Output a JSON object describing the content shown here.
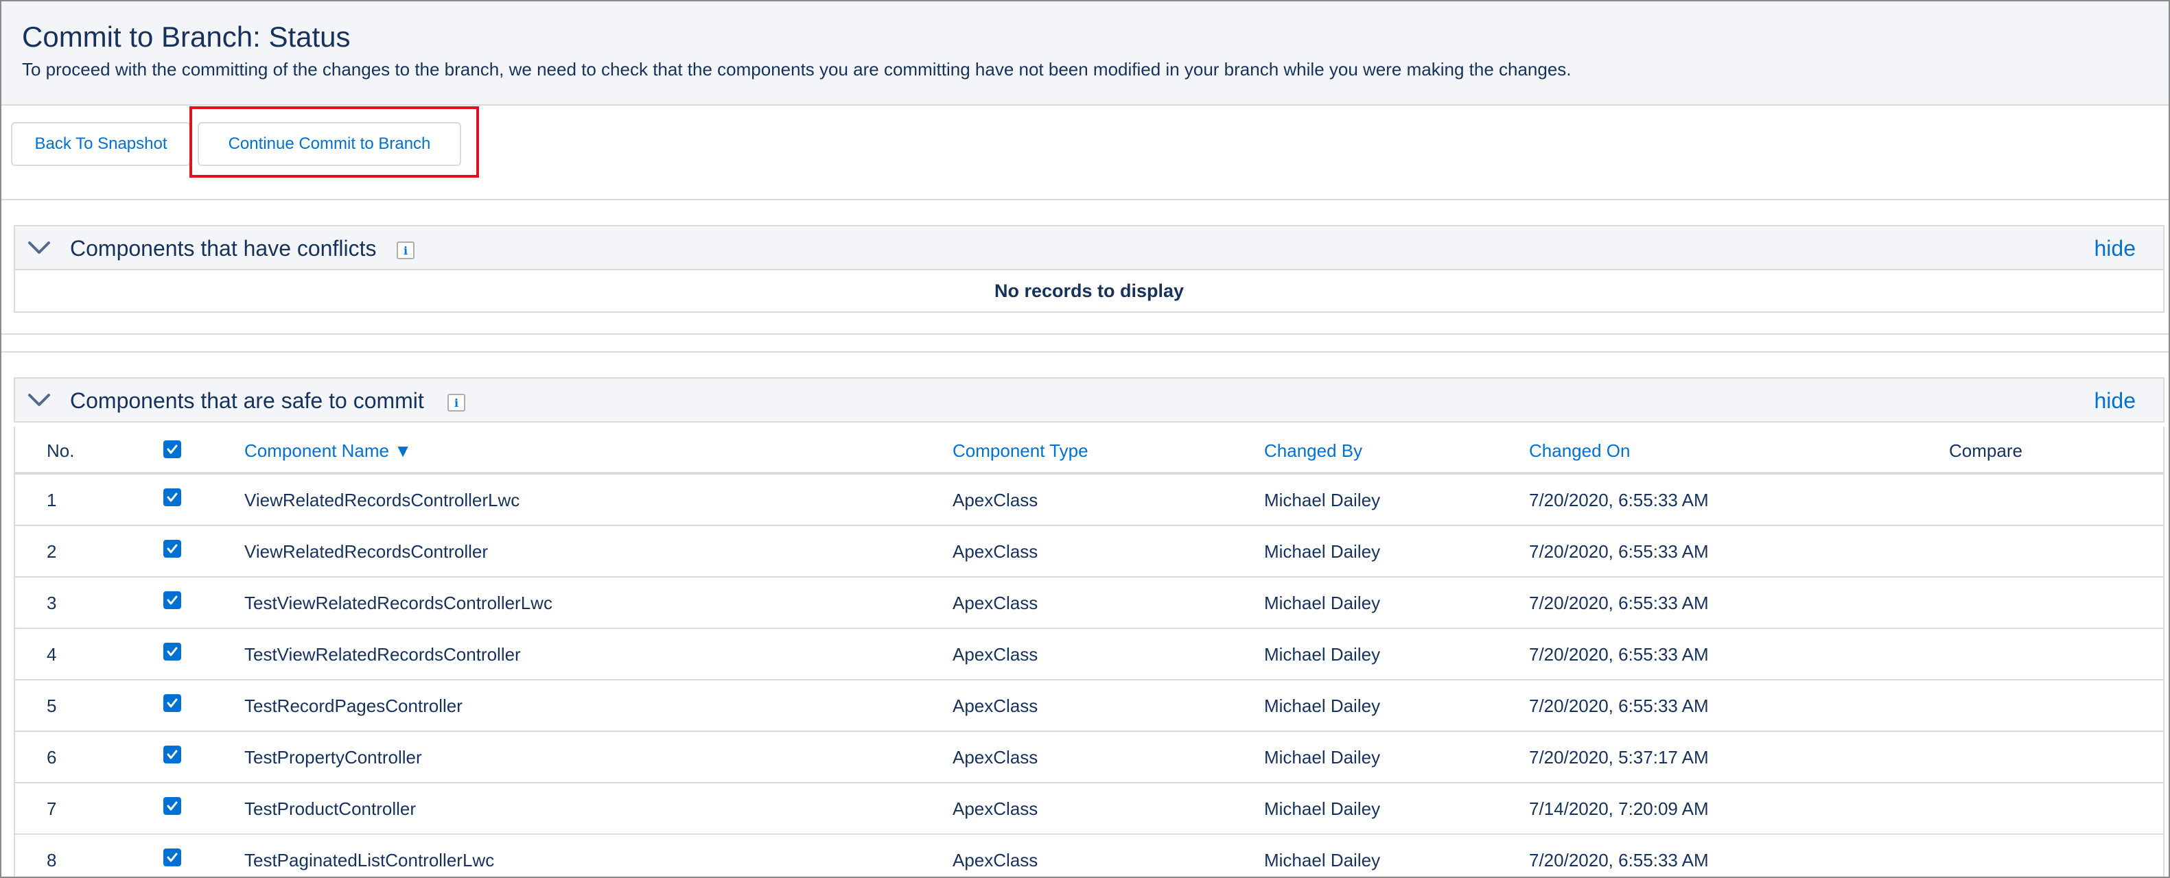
{
  "header": {
    "title": "Commit to Branch: Status",
    "description": "To proceed with the committing of the changes to the branch, we need to check that the components you are committing have not been modified in your branch while you were making the changes."
  },
  "toolbar": {
    "back_label": "Back To Snapshot",
    "continue_label": "Continue Commit to Branch"
  },
  "conflicts": {
    "title": "Components that have conflicts",
    "hide_label": "hide",
    "empty_message": "No records to display"
  },
  "safe": {
    "title": "Components that are safe to commit",
    "hide_label": "hide",
    "columns": {
      "no": "No.",
      "name": "Component Name",
      "sort_indicator": "▼",
      "type": "Component Type",
      "changed_by": "Changed By",
      "changed_on": "Changed On",
      "compare": "Compare"
    },
    "header_checked": true,
    "rows": [
      {
        "no": "1",
        "checked": true,
        "name": "ViewRelatedRecordsControllerLwc",
        "type": "ApexClass",
        "changed_by": "Michael Dailey",
        "changed_on": "7/20/2020, 6:55:33 AM"
      },
      {
        "no": "2",
        "checked": true,
        "name": "ViewRelatedRecordsController",
        "type": "ApexClass",
        "changed_by": "Michael Dailey",
        "changed_on": "7/20/2020, 6:55:33 AM"
      },
      {
        "no": "3",
        "checked": true,
        "name": "TestViewRelatedRecordsControllerLwc",
        "type": "ApexClass",
        "changed_by": "Michael Dailey",
        "changed_on": "7/20/2020, 6:55:33 AM"
      },
      {
        "no": "4",
        "checked": true,
        "name": "TestViewRelatedRecordsController",
        "type": "ApexClass",
        "changed_by": "Michael Dailey",
        "changed_on": "7/20/2020, 6:55:33 AM"
      },
      {
        "no": "5",
        "checked": true,
        "name": "TestRecordPagesController",
        "type": "ApexClass",
        "changed_by": "Michael Dailey",
        "changed_on": "7/20/2020, 6:55:33 AM"
      },
      {
        "no": "6",
        "checked": true,
        "name": "TestPropertyController",
        "type": "ApexClass",
        "changed_by": "Michael Dailey",
        "changed_on": "7/20/2020, 5:37:17 AM"
      },
      {
        "no": "7",
        "checked": true,
        "name": "TestProductController",
        "type": "ApexClass",
        "changed_by": "Michael Dailey",
        "changed_on": "7/14/2020, 7:20:09 AM"
      },
      {
        "no": "8",
        "checked": true,
        "name": "TestPaginatedListControllerLwc",
        "type": "ApexClass",
        "changed_by": "Michael Dailey",
        "changed_on": "7/20/2020, 6:55:33 AM"
      }
    ]
  },
  "colors": {
    "accent": "#0070d2",
    "text": "#16325c",
    "highlight": "#e3101f",
    "header_bg": "#f3f5f8",
    "border": "#dddbda"
  }
}
